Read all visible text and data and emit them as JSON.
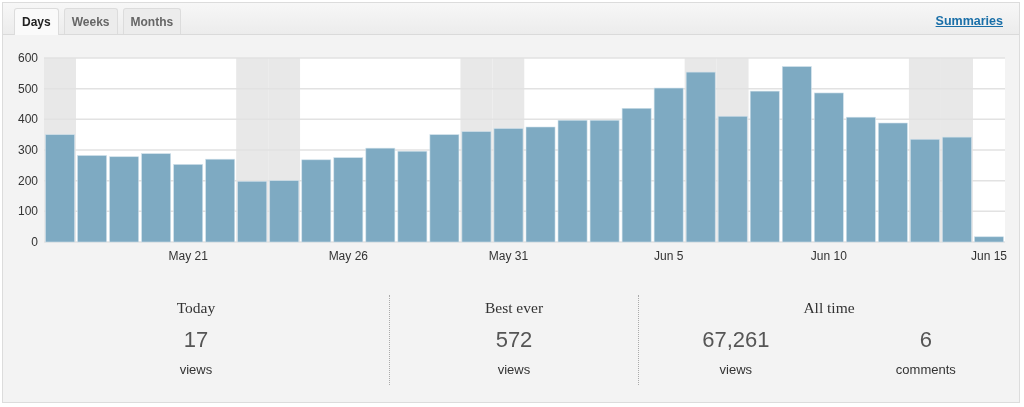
{
  "tabs": [
    {
      "label": "Days",
      "selected": true
    },
    {
      "label": "Weeks",
      "selected": false
    },
    {
      "label": "Months",
      "selected": false
    }
  ],
  "summaries_link": "Summaries",
  "chart_data": {
    "type": "bar",
    "categories": [
      null,
      null,
      null,
      null,
      "May 21",
      null,
      null,
      null,
      null,
      "May 26",
      null,
      null,
      null,
      null,
      "May 31",
      null,
      null,
      null,
      null,
      "Jun 5",
      null,
      null,
      null,
      null,
      "Jun 10",
      null,
      null,
      null,
      null,
      "Jun 15"
    ],
    "series": [
      {
        "color": "#7eaac2",
        "values": [
          350,
          282,
          278,
          288,
          253,
          270,
          198,
          200,
          268,
          275,
          306,
          296,
          350,
          360,
          370,
          375,
          397,
          397,
          436,
          502,
          554,
          410,
          492,
          572,
          486,
          407,
          388,
          335,
          342,
          17
        ]
      }
    ],
    "ylim": [
      0,
      600
    ],
    "yticks": [
      0,
      100,
      200,
      300,
      400,
      500,
      600
    ],
    "grid": true
  },
  "day_columns": [
    {
      "shaded": true
    },
    {
      "shaded": false
    },
    {
      "shaded": false
    },
    {
      "shaded": false
    },
    {
      "shaded": false
    },
    {
      "shaded": false
    },
    {
      "shaded": true
    },
    {
      "shaded": true
    },
    {
      "shaded": false
    },
    {
      "shaded": false
    },
    {
      "shaded": false
    },
    {
      "shaded": false
    },
    {
      "shaded": false
    },
    {
      "shaded": true
    },
    {
      "shaded": true
    },
    {
      "shaded": false
    },
    {
      "shaded": false
    },
    {
      "shaded": false
    },
    {
      "shaded": false
    },
    {
      "shaded": false
    },
    {
      "shaded": true
    },
    {
      "shaded": true
    },
    {
      "shaded": false
    },
    {
      "shaded": false
    },
    {
      "shaded": false
    },
    {
      "shaded": false
    },
    {
      "shaded": false
    },
    {
      "shaded": true
    },
    {
      "shaded": true
    },
    {
      "shaded": false
    }
  ],
  "stats": [
    {
      "title": "Today",
      "items": [
        {
          "value": "17",
          "label": "views"
        }
      ]
    },
    {
      "title": "Best ever",
      "items": [
        {
          "value": "572",
          "label": "views"
        }
      ]
    },
    {
      "title": "All time",
      "items": [
        {
          "value": "67,261",
          "label": "views"
        },
        {
          "value": "6",
          "label": "comments"
        }
      ]
    }
  ]
}
